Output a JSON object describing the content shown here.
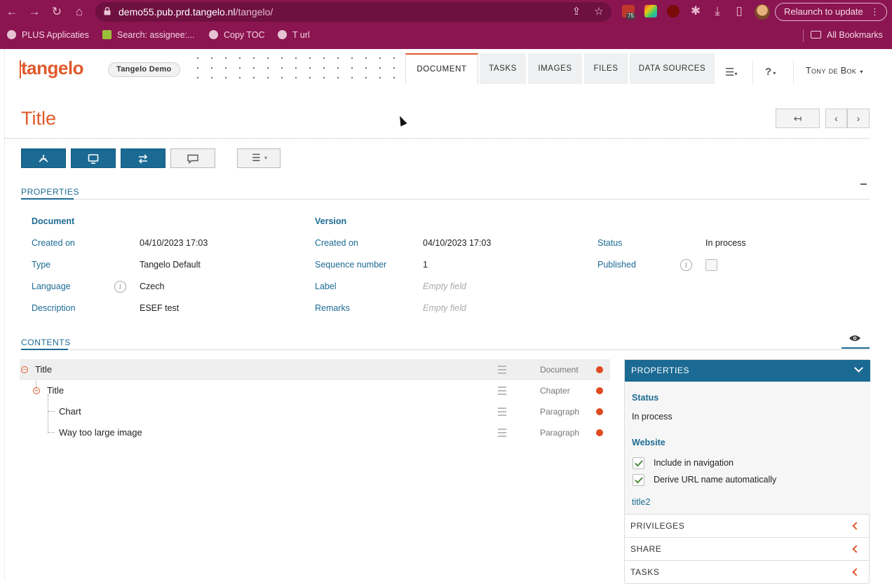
{
  "browser": {
    "url_host": "demo55.pub.prd.tangelo.nl",
    "url_path": "/tangelo/",
    "ext_badge": "75",
    "relaunch_label": "Relaunch to update",
    "bookmarks": [
      "PLUS Applicaties",
      "Search: assignee:...",
      "Copy TOC",
      "T url"
    ],
    "all_bookmarks": "All Bookmarks"
  },
  "app": {
    "logo": "tangelo",
    "environment": "Tangelo Demo",
    "tabs": [
      "DOCUMENT",
      "TASKS",
      "IMAGES",
      "FILES",
      "DATA SOURCES"
    ],
    "active_tab": "DOCUMENT",
    "help": "?",
    "user": "Tony de Bok"
  },
  "page": {
    "title": "Title"
  },
  "properties": {
    "section_title": "PROPERTIES",
    "document": {
      "heading": "Document",
      "rows": [
        {
          "label": "Created on",
          "value": "04/10/2023 17:03"
        },
        {
          "label": "Type",
          "value": "Tangelo Default"
        },
        {
          "label": "Language",
          "value": "Czech"
        },
        {
          "label": "Description",
          "value": "ESEF test"
        }
      ]
    },
    "version": {
      "heading": "Version",
      "rows": [
        {
          "label": "Created on",
          "value": "04/10/2023 17:03"
        },
        {
          "label": "Sequence number",
          "value": "1"
        },
        {
          "label": "Label",
          "value": "Empty field"
        },
        {
          "label": "Remarks",
          "value": "Empty field"
        }
      ]
    },
    "status": {
      "rows": [
        {
          "label": "Status",
          "value": "In process"
        },
        {
          "label": "Published",
          "value": ""
        }
      ]
    }
  },
  "contents": {
    "section_title": "CONTENTS",
    "tree": [
      {
        "label": "Title",
        "type": "Document",
        "level": 0
      },
      {
        "label": "Title",
        "type": "Chapter",
        "level": 1
      },
      {
        "label": "Chart",
        "type": "Paragraph",
        "level": 2
      },
      {
        "label": "Way too large image",
        "type": "Paragraph",
        "level": 2
      }
    ]
  },
  "side_panel": {
    "header": "PROPERTIES",
    "status_heading": "Status",
    "status_value": "In process",
    "website_heading": "Website",
    "include_nav": "Include in navigation",
    "derive_url": "Derive URL name automatically",
    "url_name": "title2",
    "accordions": [
      "PRIVILEGES",
      "SHARE",
      "TASKS"
    ]
  },
  "colors": {
    "brand": "#e0592a",
    "accent": "#1b6a93",
    "chrome": "#8b1550"
  }
}
